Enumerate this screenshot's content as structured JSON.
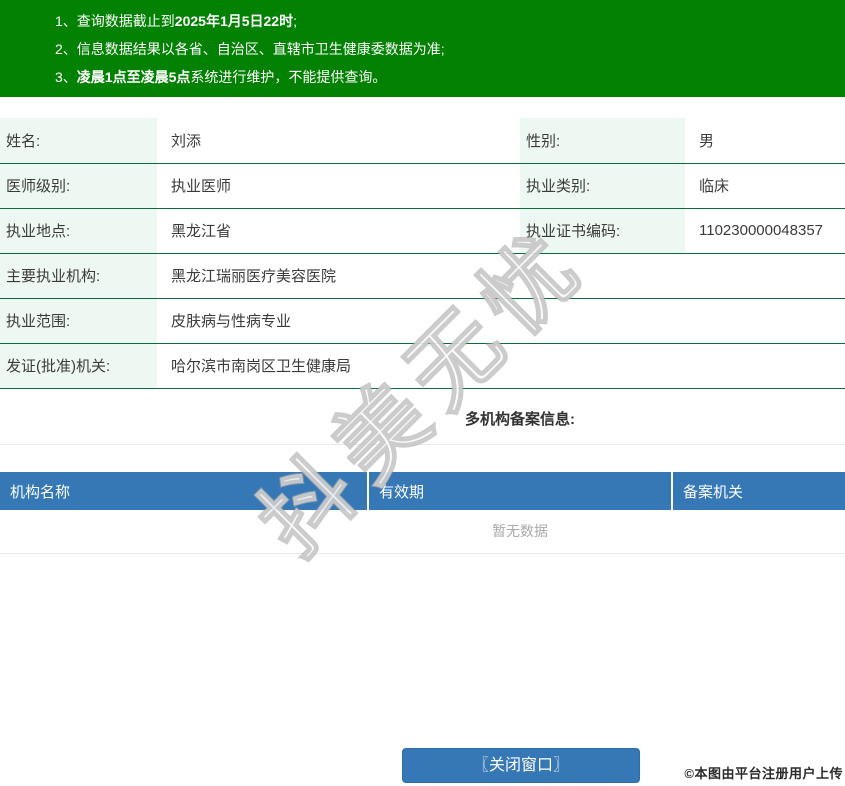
{
  "notices": [
    {
      "num": "1、",
      "pre": "查询数据截止到",
      "bold": "2025年1月5日22时",
      "post": ";"
    },
    {
      "num": "2、",
      "pre": "信息数据结果以各省、自治区、直辖市卫生健康委数据为准;",
      "bold": "",
      "post": ""
    },
    {
      "num": "3、",
      "pre": "",
      "bold": "凌晨1点至凌晨5点",
      "post": "系统进行维护，不能提供查询。"
    }
  ],
  "doctor": {
    "name_label": "姓名:",
    "name": "刘添",
    "gender_label": "性别:",
    "gender": "男",
    "level_label": "医师级别:",
    "level": "执业医师",
    "category_label": "执业类别:",
    "category": "临床",
    "location_label": "执业地点:",
    "location": "黑龙江省",
    "cert_no_label": "执业证书编码:",
    "cert_no": "110230000048357",
    "main_org_label": "主要执业机构:",
    "main_org": "黑龙江瑞丽医疗美容医院",
    "scope_label": "执业范围:",
    "scope": "皮肤病与性病专业",
    "authority_label": "发证(批准)机关:",
    "authority": "哈尔滨市南岗区卫生健康局"
  },
  "multi_org": {
    "heading": "多机构备案信息:",
    "columns": [
      "机构名称",
      "有效期",
      "备案机关"
    ],
    "empty_text": "暂无数据"
  },
  "footer": {
    "close_button": "〖关闭窗口〗",
    "copyright": "©本图由平台注册用户上传"
  },
  "watermark_text": "抖美无忧",
  "colors": {
    "banner_green": "#028102",
    "table_border_green": "#086e3f",
    "label_bg_mint": "#edf8f2",
    "header_blue": "#3578b5",
    "light_border": "#e9e9e9"
  }
}
